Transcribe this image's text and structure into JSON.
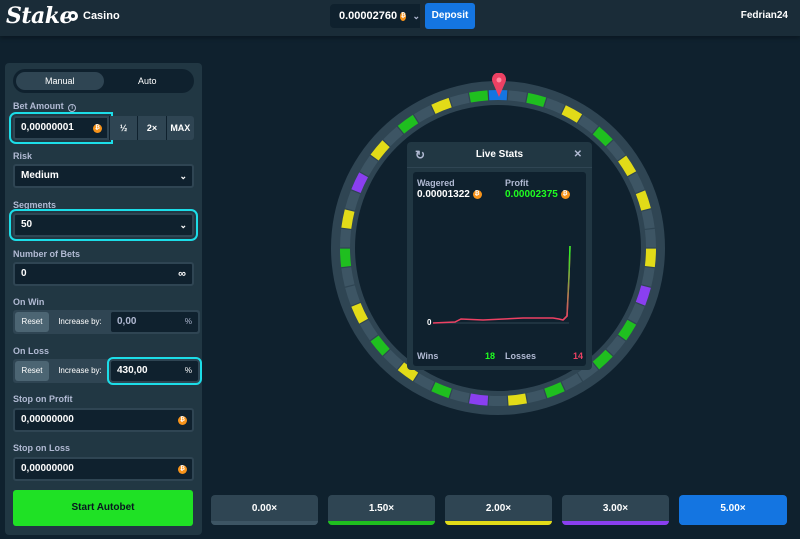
{
  "header": {
    "logo": "Stake",
    "casino_label": "Casino",
    "balance": "0.00002760",
    "deposit_label": "Deposit",
    "username": "Fedrian24"
  },
  "sidebar": {
    "tabs": [
      {
        "label": "Manual"
      },
      {
        "label": "Auto"
      }
    ],
    "active_tab": "Auto",
    "bet_amount_label": "Bet Amount",
    "bet_amount_value": "0,00000001",
    "half_label": "½",
    "double_label": "2×",
    "max_label": "MAX",
    "risk_label": "Risk",
    "risk_value": "Medium",
    "segments_label": "Segments",
    "segments_value": "50",
    "num_bets_label": "Number of Bets",
    "num_bets_value": "0",
    "infinity": "∞",
    "on_win_label": "On Win",
    "on_win_reset": "Reset",
    "on_win_increase": "Increase by:",
    "on_win_value": "0,00",
    "on_loss_label": "On Loss",
    "on_loss_reset": "Reset",
    "on_loss_increase": "Increase by:",
    "on_loss_value": "430,00",
    "percent": "%",
    "stop_profit_label": "Stop on Profit",
    "stop_profit_value": "0,00000000",
    "stop_loss_label": "Stop on Loss",
    "stop_loss_value": "0,00000000",
    "start_label": "Start Autobet"
  },
  "live_stats": {
    "title": "Live Stats",
    "wagered_label": "Wagered",
    "wagered_value": "0.00001322",
    "profit_label": "Profit",
    "profit_value": "0.00002375",
    "zero_label": "0",
    "wins_label": "Wins",
    "wins_value": "18",
    "losses_label": "Losses",
    "losses_value": "14"
  },
  "multipliers": [
    {
      "label": "0.00×",
      "color": "#3d5564"
    },
    {
      "label": "1.50×",
      "color": "#1fbf1f"
    },
    {
      "label": "2.00×",
      "color": "#e2db18"
    },
    {
      "label": "3.00×",
      "color": "#8a3ff0"
    },
    {
      "label": "5.00×",
      "color": "#1475e1"
    }
  ],
  "colors": {
    "accent_green": "#1fff20",
    "accent_blue": "#1475e1",
    "highlight": "#1cdde8",
    "profit_green": "#1fff20",
    "loss_red": "#ed4163"
  },
  "wheel_segments": [
    "blue",
    "gray",
    "green",
    "gray",
    "yellow",
    "gray",
    "green",
    "gray",
    "yellow",
    "gray",
    "yellow",
    "gray",
    "gray",
    "yellow",
    "gray",
    "purple",
    "gray",
    "green",
    "gray",
    "green",
    "gray",
    "gray",
    "green",
    "gray",
    "yellow",
    "gray",
    "purple",
    "gray",
    "green",
    "gray",
    "yellow",
    "gray",
    "green",
    "gray",
    "yellow",
    "gray",
    "gray",
    "green",
    "gray",
    "yellow",
    "gray",
    "purple",
    "gray",
    "yellow",
    "gray",
    "green",
    "gray",
    "yellow",
    "gray",
    "green"
  ]
}
